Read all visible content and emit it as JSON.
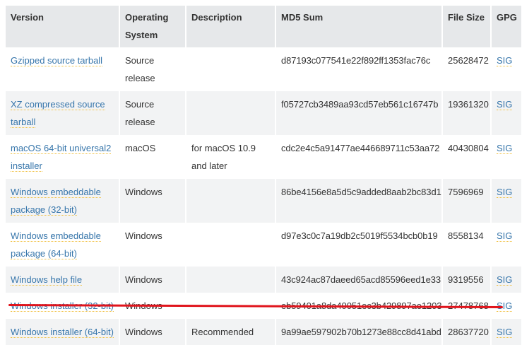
{
  "headers": {
    "version": "Version",
    "os": "Operating System",
    "description": "Description",
    "md5": "MD5 Sum",
    "size": "File Size",
    "gpg": "GPG"
  },
  "rows": [
    {
      "version": "Gzipped source tarball",
      "os": "Source release",
      "description": "",
      "md5": "d87193c077541e22f892ff1353fac76c",
      "size": "25628472",
      "gpg": "SIG"
    },
    {
      "version": "XZ compressed source tarball",
      "os": "Source release",
      "description": "",
      "md5": "f05727cb3489aa93cd57eb561c16747b",
      "size": "19361320",
      "gpg": "SIG"
    },
    {
      "version": "macOS 64-bit universal2 installer",
      "os": "macOS",
      "description": "for macOS 10.9 and later",
      "md5": "cdc2e4c5a91477ae446689711c53aa72",
      "size": "40430804",
      "gpg": "SIG"
    },
    {
      "version": "Windows embeddable package (32-bit)",
      "os": "Windows",
      "description": "",
      "md5": "86be4156e8a5d5c9added8aab2bc83d1",
      "size": "7596969",
      "gpg": "SIG"
    },
    {
      "version": "Windows embeddable package (64-bit)",
      "os": "Windows",
      "description": "",
      "md5": "d97e3c0c7a19db2c5019f5534bcb0b19",
      "size": "8558134",
      "gpg": "SIG"
    },
    {
      "version": "Windows help file",
      "os": "Windows",
      "description": "",
      "md5": "43c924ac87daeed65acd85596eed1e33",
      "size": "9319556",
      "gpg": "SIG"
    },
    {
      "version": "Windows installer (32-bit)",
      "os": "Windows",
      "description": "",
      "md5": "eb59401a8da40051ec3b429897ae1203",
      "size": "27478768",
      "gpg": "SIG"
    },
    {
      "version": "Windows installer (64-bit)",
      "os": "Windows",
      "description": "Recommended",
      "md5": "9a99ae597902b70b1273e88cc8d41abd",
      "size": "28637720",
      "gpg": "SIG"
    }
  ],
  "colors": {
    "link": "#3776ab",
    "header_bg": "#e6e8ea",
    "alt_row_bg": "#f2f3f4",
    "annotation": "#e0141c"
  }
}
